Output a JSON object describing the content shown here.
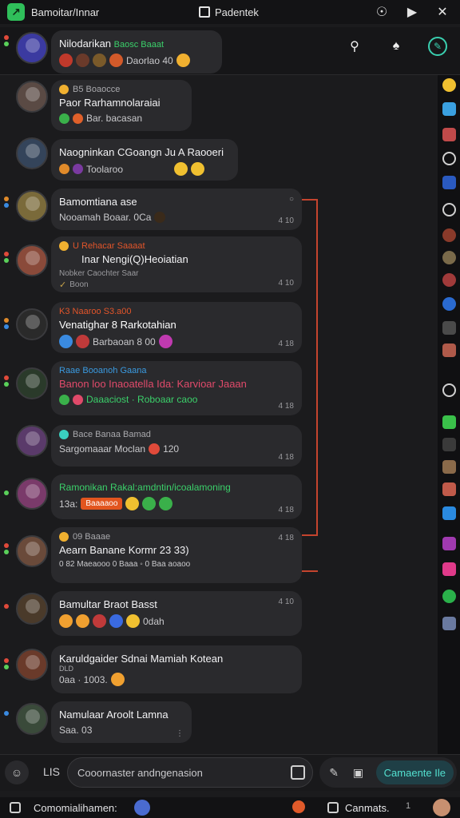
{
  "window": {
    "app_title": "Bamoitar/Innar",
    "tab_title": "Padentek"
  },
  "pinned": {
    "name": "Nilodarikan",
    "tag": "Baosc Baaat",
    "preview": "Daorlao 40"
  },
  "messages": [
    {
      "meta": "B5 Boaocce",
      "name": "Paor Rarhamnolaraiai",
      "preview": "Bar. bacasan",
      "time": ""
    },
    {
      "meta": "",
      "name": "Naogninkan CGoangn Ju A Raooeri",
      "preview": "Toolaroo",
      "time": ""
    },
    {
      "meta": "",
      "name": "Bamomtiana ase",
      "preview": "Nooamah Boaar. 0Ca",
      "time": "4 10"
    },
    {
      "meta": "U Rehacar Saaaat",
      "name": "Inar Nengi(Q)Heoiatian",
      "preview": "Nobker  Caochter Saar",
      "sub": "Boon",
      "time": "4 10"
    },
    {
      "meta": "K3 Naaroo S3.a00",
      "name": "Venatighar  8  Rarkotahian",
      "preview": "Barbaoan 8 00",
      "time": "4 18"
    },
    {
      "meta": "Raae Booanoh Gaana",
      "name": "Banon loo Inaoatella Ida: Karvioar Jaaan",
      "preview": "Daaaciost  ·  Roboaar  caoo",
      "time": "4 18"
    },
    {
      "meta": "Bace Banaa Bamad",
      "name": "Sargomaaar Moclan",
      "preview": "120",
      "time": "4 18"
    },
    {
      "meta": "",
      "name": "Ramonikan Rakal:amdntin/icoalamoning",
      "preview": "13a:",
      "chip": "Baaaaoo",
      "time": "4 18"
    },
    {
      "meta": "09 Baaae",
      "name": "Aearn Banane Kormr 23 33)",
      "preview": "0 82  Maeaooo  0 Baaa  ◦  0 Baa aoaoo",
      "time": "4 18"
    },
    {
      "meta": "",
      "name": "Bamultar Braot Basst",
      "preview": "0dah",
      "time": "4 10"
    },
    {
      "meta": "",
      "name": "Karuldgaider Sdnai Mamiah Kotean",
      "sub": "DLD",
      "preview": "0aa · 1003.",
      "time": ""
    },
    {
      "meta": "",
      "name": "Namulaar Aroolt Lamna",
      "preview": "Saa. 03",
      "time": ""
    }
  ],
  "composer": {
    "mode_label": "LIS",
    "placeholder": "Cooornaster andngenasion",
    "send_label": "Camaente Ile"
  },
  "statusbar": {
    "left_label": "Comomialihamen:",
    "right_label": "Canmats.",
    "count": "1"
  },
  "colors": {
    "accent": "#2fbf5a",
    "connector": "#c4442e",
    "send": "#53e0d0"
  },
  "icons": [
    "search-icon",
    "spade-icon",
    "compose-icon",
    "lock-icon",
    "play-icon",
    "close-icon"
  ]
}
